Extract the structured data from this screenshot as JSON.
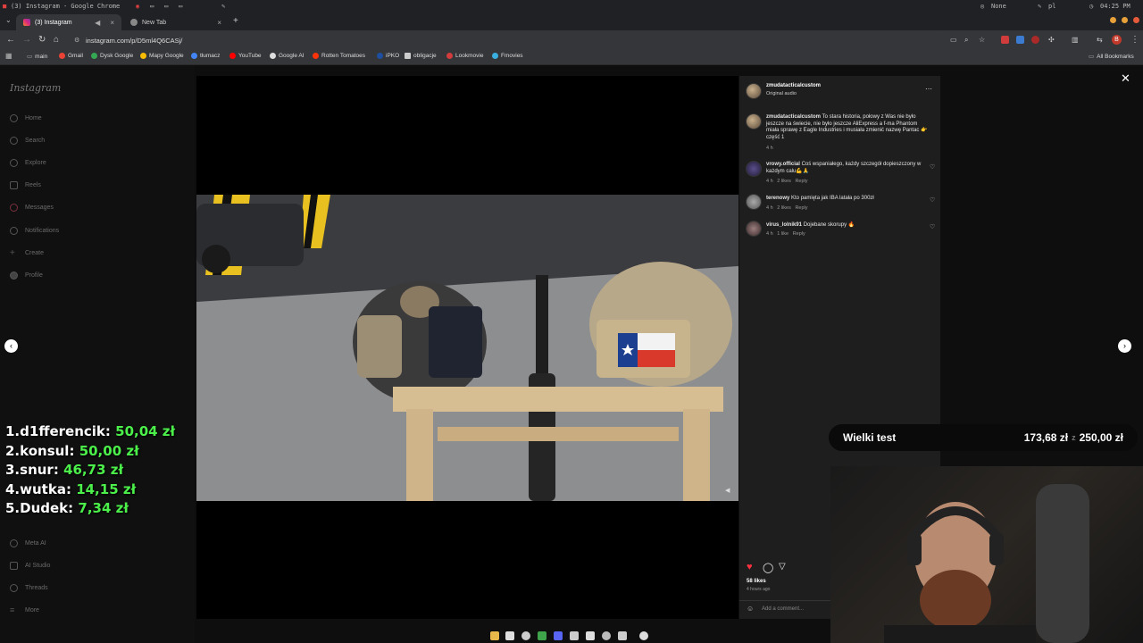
{
  "system_bar": {
    "window_title": "(3) Instagram - Google Chrome",
    "keyboard_layout": "pl",
    "network": "None",
    "clock": "04:25 PM"
  },
  "tabs": [
    {
      "title": "(3) Instagram",
      "active": true
    },
    {
      "title": "New Tab",
      "active": false
    }
  ],
  "address_bar": {
    "url": "instagram.com/p/D5ml4Q6CASj/"
  },
  "bookmarks": [
    {
      "label": "main",
      "color": "#aaaaaa"
    },
    {
      "label": "Gmail",
      "color": "#ea4335"
    },
    {
      "label": "Dysk Google",
      "color": "#34a853"
    },
    {
      "label": "Mapy Google",
      "color": "#fbbc05"
    },
    {
      "label": "tłumacz",
      "color": "#4285f4"
    },
    {
      "label": "YouTube",
      "color": "#ff0000"
    },
    {
      "label": "Google AI",
      "color": "#dddddd"
    },
    {
      "label": "Rotten Tomatoes",
      "color": "#fa320a"
    },
    {
      "label": "iPKO",
      "color": "#1d4ea0"
    },
    {
      "label": "obligacje",
      "color": "#cccccc"
    },
    {
      "label": "Lookmovie",
      "color": "#d23c3c"
    },
    {
      "label": "Fmovies",
      "color": "#3ab0e0"
    }
  ],
  "all_bookmarks_label": "All Bookmarks",
  "instagram": {
    "logo": "Instagram",
    "nav": [
      "Home",
      "Search",
      "Explore",
      "Reels",
      "Messages",
      "Notifications",
      "Create",
      "Profile"
    ],
    "nav_bottom": [
      "Meta AI",
      "AI Studio",
      "Threads",
      "More"
    ]
  },
  "post": {
    "author": "zmudatacticalcustom",
    "audio": "Original audio",
    "caption_author": "zmudatacticalcustom",
    "caption": "To stara historia, połowy z Was nie było jeszcze na świecie, nie było jeszcze AliExpress a f-ma Phantom miała sprawę z Eagle Industries i musiała zmienić nazwę Pantac 👉 część 1",
    "caption_time": "4 h",
    "comments": [
      {
        "user": "vrowy.official",
        "text": "Coś wspaniałego, każdy szczegół dopieszczony w każdym calu💪🙏",
        "time": "4 h",
        "likes": "2 likes",
        "reply": "Reply"
      },
      {
        "user": "terenowy",
        "text": "Kto pamięta jak IBA latała po 300zł",
        "time": "4 h",
        "likes": "2 likes",
        "reply": "Reply"
      },
      {
        "user": "virus_lolnik91",
        "text": "Dojebane skorupy 🔥",
        "time": "4 h",
        "likes": "1 like",
        "reply": "Reply"
      }
    ],
    "likes": "58 likes",
    "posted": "4 hours ago",
    "add_comment_placeholder": "Add a comment..."
  },
  "leaderboard": [
    {
      "rank": "1.",
      "name": "d1fferencik:",
      "amount": "50,04 zł"
    },
    {
      "rank": "2.",
      "name": "konsul:",
      "amount": "50,00 zł"
    },
    {
      "rank": "3.",
      "name": "snur:",
      "amount": "46,73 zł"
    },
    {
      "rank": "4.",
      "name": "wutka:",
      "amount": "14,15 zł"
    },
    {
      "rank": "5.",
      "name": "Dudek:",
      "amount": "7,34 zł"
    }
  ],
  "goal": {
    "title": "Wielki test",
    "current": "173,68 zł",
    "separator": "z",
    "target": "250,00 zł"
  },
  "colors": {
    "accent_green": "#4cf04a",
    "ig_red": "#ff3040"
  }
}
